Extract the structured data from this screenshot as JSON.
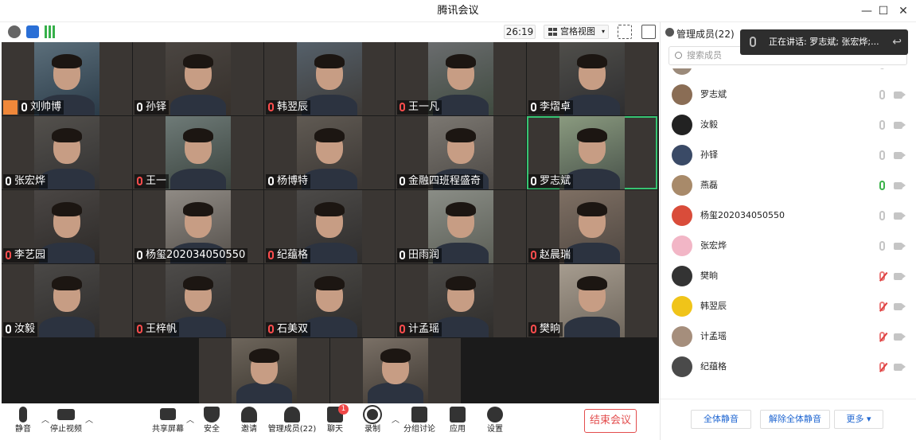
{
  "window": {
    "title": "腾讯会议"
  },
  "topbar": {
    "timer": "26:19",
    "view_label": "宫格视图"
  },
  "tiles": [
    {
      "name": "刘帅博",
      "mic": "on",
      "host": true
    },
    {
      "name": "孙铎",
      "mic": "on"
    },
    {
      "name": "韩翌辰",
      "mic": "off"
    },
    {
      "name": "王一凡",
      "mic": "off"
    },
    {
      "name": "李熠卓",
      "mic": "on"
    },
    {
      "name": "张宏烨",
      "mic": "on"
    },
    {
      "name": "王一",
      "mic": "off"
    },
    {
      "name": "杨博特",
      "mic": "on"
    },
    {
      "name": "金融四班程盛奇",
      "mic": "on"
    },
    {
      "name": "罗志斌",
      "mic": "on",
      "active": true
    },
    {
      "name": "李艺园",
      "mic": "off"
    },
    {
      "name": "杨玺202034050550",
      "mic": "on"
    },
    {
      "name": "纪蕴格",
      "mic": "off"
    },
    {
      "name": "田雨润",
      "mic": "on"
    },
    {
      "name": "赵晨瑞",
      "mic": "off"
    },
    {
      "name": "汝毅",
      "mic": "on"
    },
    {
      "name": "王梓帆",
      "mic": "off"
    },
    {
      "name": "石美双",
      "mic": "off"
    },
    {
      "name": "计孟瑶",
      "mic": "off"
    },
    {
      "name": "樊晌",
      "mic": "off"
    }
  ],
  "toolbar": {
    "mute": "静音",
    "stop_video": "停止视频",
    "share": "共享屏幕",
    "security": "安全",
    "invite": "邀请",
    "members": "管理成员(22)",
    "chat": "聊天",
    "chat_badge": "1",
    "record": "录制",
    "breakout": "分组讨论",
    "apps": "应用",
    "settings": "设置",
    "end": "结束会议"
  },
  "panel": {
    "title": "管理成员(22)",
    "search_placeholder": "搜索成员",
    "speaking": "正在讲话: 罗志斌; 张宏烨;...",
    "members": [
      {
        "name": "罗志斌",
        "mic": "idle"
      },
      {
        "name": "汝毅",
        "mic": "idle"
      },
      {
        "name": "孙铎",
        "mic": "idle"
      },
      {
        "name": "燕磊",
        "mic": "on"
      },
      {
        "name": "杨玺202034050550",
        "mic": "idle"
      },
      {
        "name": "张宏烨",
        "mic": "idle"
      },
      {
        "name": "樊晌",
        "mic": "off"
      },
      {
        "name": "韩翌辰",
        "mic": "off"
      },
      {
        "name": "计孟瑶",
        "mic": "off"
      },
      {
        "name": "纪蕴格",
        "mic": "off"
      }
    ],
    "mute_all": "全体静音",
    "unmute_all": "解除全体静音",
    "more": "更多 ▾"
  },
  "colors": {
    "accent": "#1f66d1",
    "end": "#e34d4d",
    "active_speaker": "#37c472",
    "host": "#f0883a"
  }
}
